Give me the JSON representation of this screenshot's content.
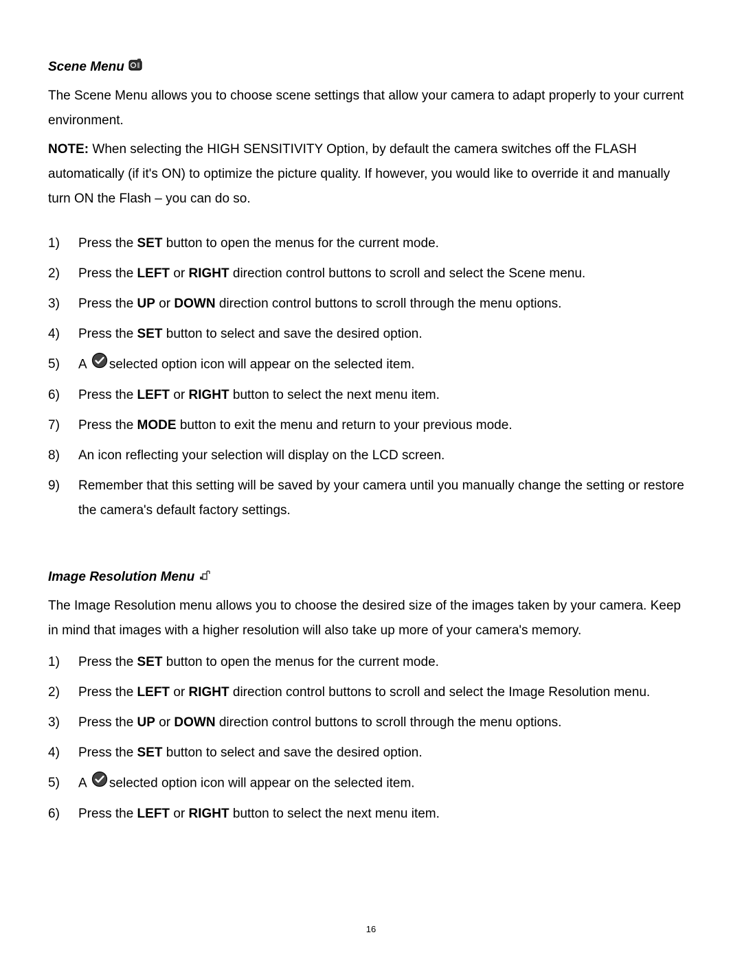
{
  "scene": {
    "heading": "Scene Menu",
    "intro": "The Scene Menu allows you to choose scene settings that allow your camera to adapt properly to your current environment.",
    "note_label": "NOTE:",
    "note_text": "   When selecting the HIGH SENSITIVITY Option, by default the camera switches off the FLASH automatically (if it's ON) to optimize the picture quality. If however, you would like to override it and manually turn ON the Flash – you can do so.",
    "items": [
      {
        "num": "1)",
        "pre": "Press the ",
        "b1": "SET",
        "post": " button to open the menus for the current mode."
      },
      {
        "num": "2)",
        "pre": "Press the ",
        "b1": "LEFT",
        "mid1": " or ",
        "b2": "RIGHT",
        "post": " direction control buttons to scroll and select the Scene menu."
      },
      {
        "num": "3)",
        "pre": "Press the ",
        "b1": "UP",
        "mid1": " or ",
        "b2": "DOWN",
        "post": " direction control buttons to scroll through the menu options."
      },
      {
        "num": "4)",
        "pre": "Press the ",
        "b1": "SET",
        "post": " button to select and save the desired option."
      },
      {
        "num": "5)",
        "pre": "A  ",
        "icon": true,
        "post": "selected option icon will appear on the selected item."
      },
      {
        "num": "6)",
        "pre": "Press the ",
        "b1": "LEFT",
        "mid1": " or ",
        "b2": "RIGHT",
        "post": " button to select the next menu item."
      },
      {
        "num": "7)",
        "pre": "Press the ",
        "b1": "MODE",
        "post": " button to exit the menu and return to your previous mode."
      },
      {
        "num": "8)",
        "pre": "An icon reflecting your selection will display on the LCD screen."
      },
      {
        "num": "9)",
        "pre": "Remember that this setting will be saved by your camera until you manually change the setting or restore the camera's default factory settings."
      }
    ]
  },
  "resolution": {
    "heading": "Image Resolution Menu",
    "intro": "The Image Resolution menu allows you to choose the desired size of the images taken by your camera. Keep in mind that images with a higher resolution will also take up more of your camera's memory.",
    "items": [
      {
        "num": "1)",
        "pre": "Press the ",
        "b1": "SET",
        "post": " button to open the menus for the current mode."
      },
      {
        "num": "2)",
        "pre": "Press the ",
        "b1": "LEFT",
        "mid1": " or ",
        "b2": "RIGHT",
        "post": " direction control buttons to scroll and select the Image Resolution menu."
      },
      {
        "num": "3)",
        "pre": "Press the ",
        "b1": "UP",
        "mid1": " or ",
        "b2": "DOWN",
        "post": " direction control buttons to scroll through the menu options."
      },
      {
        "num": "4)",
        "pre": "Press the ",
        "b1": "SET",
        "post": " button to select and save the desired option."
      },
      {
        "num": "5)",
        "pre": "A  ",
        "icon": true,
        "post": "selected option icon will appear on the selected item."
      },
      {
        "num": "6)",
        "pre": "Press the ",
        "b1": "LEFT",
        "mid1": " or ",
        "b2": "RIGHT",
        "post": " button to select the next menu item."
      }
    ]
  },
  "page_number": "16"
}
